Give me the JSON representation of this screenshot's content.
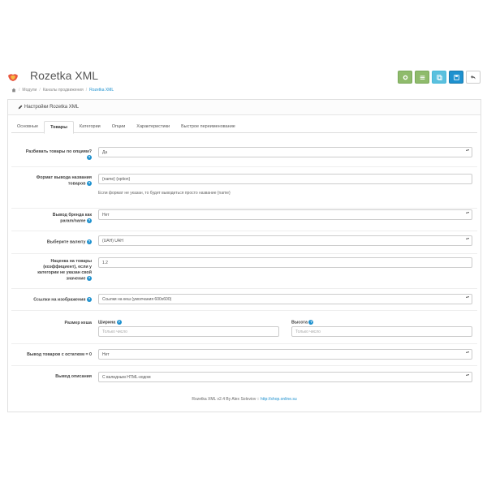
{
  "header": {
    "title": "Rozetka XML",
    "logo_icon": "opencart-logo-icon",
    "toolbar": [
      {
        "icon": "gear-icon",
        "color": "#8fbb6c"
      },
      {
        "icon": "list-icon",
        "color": "#8fbb6c"
      },
      {
        "icon": "copy-icon",
        "color": "#5bc0de"
      },
      {
        "icon": "save-icon",
        "color": "#1e91cf"
      },
      {
        "icon": "back-arrow-icon",
        "color": "#ffffff"
      }
    ]
  },
  "breadcrumb": {
    "home_icon": "home-icon",
    "items": [
      "Модули",
      "Каналы продвижения",
      "Rozetka XML"
    ]
  },
  "panel": {
    "heading": "Настройки Rozetka XML",
    "heading_icon": "pencil-icon"
  },
  "tabs": [
    "Основные",
    "Товары",
    "Категории",
    "Опции",
    "Характеристики",
    "Быстрое переименование"
  ],
  "active_tab": "Товары",
  "form": {
    "split_by_option": {
      "label": "Разбивать товары по опциям?",
      "value": "Да"
    },
    "name_format": {
      "label": "Формат вывода названия товаров",
      "value": "{name} {option}",
      "help": "Если формат не указан, то будет выводиться просто название {name}"
    },
    "brand_param": {
      "label": "Вывод бренда как param/name",
      "value": "Нет"
    },
    "currency": {
      "label": "Выберите валюту",
      "value": "(UAH) UAH"
    },
    "markup": {
      "label": "Наценка на товары (коэффициент), если у категории не указан свой значение",
      "value": "1.2"
    },
    "image_links": {
      "label": "Ссылки на изображения",
      "value": "Ссылки на кеш (умолчания 600х600)"
    },
    "cache_size": {
      "label": "Размер кеша",
      "width_label": "Ширина",
      "width_placeholder": "Только число",
      "height_label": "Высота",
      "height_placeholder": "Только число"
    },
    "stock_zero": {
      "label": "Вывод товаров с остатком = 0",
      "value": "Нет"
    },
    "description": {
      "label": "Вывод описания",
      "value": "С валидным HTML-кодом"
    }
  },
  "footer": {
    "text": "Rozetka XML v2.4 By Alex Soloviov ::",
    "link": "http://shop.online.su"
  },
  "colors": {
    "accent": "#1e91cf",
    "green": "#8fbb6c"
  }
}
